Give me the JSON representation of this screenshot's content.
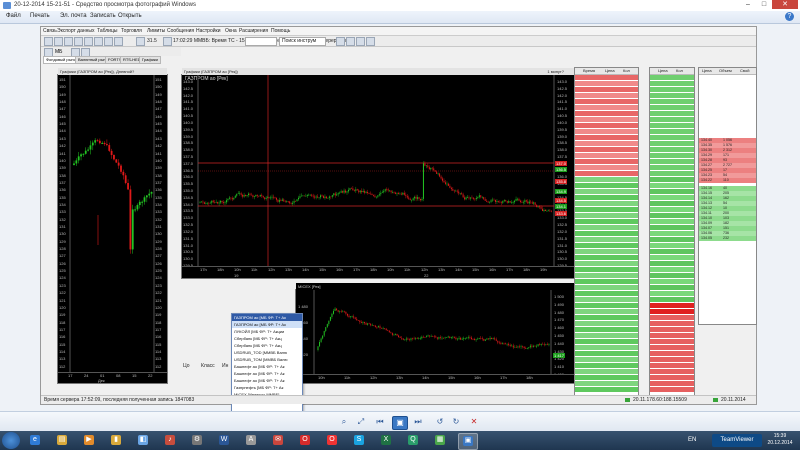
{
  "viewer": {
    "title": "20-12-2014 15-21-51 - Средство просмотра фотографий Windows",
    "menu": [
      "Файл",
      "Печать",
      "Эл. почта",
      "Записать",
      "Открыть"
    ],
    "help": "?"
  },
  "app": {
    "menu": [
      "Связь",
      "Экспорт данных",
      "Таблицы",
      "Торговля",
      "Лимиты",
      "Сообщения",
      "Настройки",
      "Окна",
      "Расширения",
      "Помощь"
    ],
    "toolbar_time": "31.5",
    "toolbar_status": "17:02:29 ММВБ: Время ТС - 15:13:32, Биннинг С 20 декабря (не перерасчет)",
    "toolbar_search": "Поиск инструм",
    "toolbar_account": "МБ",
    "tabs": [
      "Фондовый рынок",
      "Валютный рынок",
      "FORTS",
      "RTS-HEDG",
      "Графики"
    ],
    "status": "Время сервера 17:52:09, последняя полученная запись 1847083",
    "status_right": "20.11.178.60:188.15509",
    "status_date": "20.11.2014",
    "side_labels": [
      "Цо",
      "Класс",
      "Ин"
    ]
  },
  "chart_left": {
    "title": "Графики (ГАЗПРОМ ао [Рек]), Дневной?",
    "ylabels_left": [
      "151",
      "150",
      "149",
      "148",
      "147",
      "146",
      "145",
      "144",
      "143",
      "142",
      "141",
      "140",
      "139",
      "138",
      "137",
      "136",
      "135",
      "134",
      "133",
      "132",
      "131",
      "130",
      "129",
      "128",
      "127",
      "126",
      "125",
      "124",
      "123",
      "122",
      "121",
      "120",
      "119",
      "118",
      "117",
      "116",
      "115",
      "114",
      "113",
      "112",
      "111"
    ],
    "ylabels_right": [
      "151",
      "150",
      "149",
      "148",
      "147",
      "146",
      "145",
      "144",
      "143",
      "142",
      "141",
      "140",
      "139",
      "138",
      "137",
      "136",
      "135",
      "134",
      "133",
      "132",
      "131",
      "130",
      "129",
      "128",
      "127",
      "126",
      "125",
      "124",
      "123",
      "122",
      "121",
      "120",
      "119",
      "118",
      "117",
      "116",
      "115",
      "114",
      "113",
      "112",
      "111"
    ],
    "xlabels": [
      "17",
      "24",
      "01",
      "08",
      "15",
      "22"
    ],
    "xsub": "Дек"
  },
  "chart_main": {
    "title": "Графики (ГАЗПРОМ ао [Рек])",
    "subtitle": "ГАЗПРОМ ао [Рек]",
    "badge": "1 минут?",
    "ylabels_left": [
      "143.0",
      "142.5",
      "142.0",
      "141.5",
      "141.0",
      "140.5",
      "140.0",
      "139.5",
      "139.0",
      "138.5",
      "138.0",
      "137.5",
      "137.0",
      "136.5",
      "136.0",
      "135.5",
      "135.0",
      "134.5",
      "134.0",
      "133.5",
      "133.0",
      "132.5",
      "132.0",
      "131.5",
      "131.0",
      "130.5",
      "130.0",
      "129.5"
    ],
    "ylabels_right": [
      "143.0",
      "142.5",
      "142.0",
      "141.5",
      "141.0",
      "140.5",
      "140.0",
      "139.5",
      "139.0",
      "138.5",
      "138.0",
      "137.5",
      "137.0",
      "136.5",
      "136.0",
      "135.5",
      "135.0",
      "134.5",
      "134.0",
      "133.5",
      "133.0",
      "132.5",
      "132.0",
      "131.5",
      "131.0",
      "130.5",
      "130.0",
      "129.5"
    ],
    "price_tags": [
      "137.0",
      "136.5",
      "135.8",
      "134.9",
      "134.5",
      "134.1",
      "133.6"
    ],
    "xlabels": [
      "17h",
      "18h",
      "10h",
      "11h",
      "12h",
      "13h",
      "14h",
      "15h",
      "16h",
      "17h",
      "18h",
      "10h",
      "11h",
      "12h",
      "13h",
      "14h",
      "15h",
      "16h",
      "17h",
      "18h",
      "19h"
    ],
    "xsub": [
      "19",
      "22"
    ]
  },
  "chart_micex": {
    "title": "MICEX [Рек]",
    "ylabels_right": [
      "1 500",
      "1 490",
      "1 480",
      "1 470",
      "1 460",
      "1 450",
      "1 440",
      "1 430",
      "1 420",
      "1 410",
      "1 400"
    ],
    "ylabels_left": [
      "1 480",
      "1 460",
      "1 440",
      "1 420"
    ],
    "price_tag": "1 417",
    "xlabels": [
      "10h",
      "11h",
      "12h",
      "13h",
      "14h",
      "15h",
      "16h",
      "17h",
      "18h"
    ]
  },
  "instruments": {
    "header": "ГАЗПРОМ ао [МБ ФР: Т+ Ак",
    "items": [
      "ГАЗПРОМ ао [МБ ФР: Т+ Ак",
      "ЛУКОЙЛ [МБ ФР: Т+ Акции",
      "Сбербанк [МБ ФР: Т+ Акц",
      "Сбербанк [МБ ФР: Т+ Акц",
      "USDRUB_TOD [ММВБ Валю",
      "USDRUB_TOM [ММВБ Валю",
      "Башнефт ао [МБ ФР: Т+ Ак",
      "Башнефт ао [МБ ФР: Т+ Ак",
      "Башнефт ао [МБ ФР: Т+ Ак",
      "Газпрнефть [МБ ФР: Т+ Ак",
      "MICEX [Индексы ММВБ]"
    ]
  },
  "book1": {
    "title": "Тоб",
    "headers": [
      "Время",
      "Цена",
      "Кол"
    ],
    "rows_red": 17,
    "rows_green": 36
  },
  "book2": {
    "headers": [
      "Цена",
      "Кол"
    ],
    "rows": 53
  },
  "book3": {
    "headers": [
      "Цена",
      "Объем",
      "Свой"
    ],
    "ask": [
      [
        "134.40",
        "1 056"
      ],
      [
        "134.35",
        "1 576"
      ],
      [
        "134.30",
        "2 312"
      ],
      [
        "134.29",
        "171"
      ],
      [
        "134.28",
        "93"
      ],
      [
        "134.27",
        "2 727"
      ],
      [
        "134.25",
        "17"
      ],
      [
        "134.23",
        "54"
      ],
      [
        "134.22",
        "110"
      ]
    ],
    "bid": [
      [
        "134.16",
        "40"
      ],
      [
        "134.15",
        "205"
      ],
      [
        "134.14",
        "162"
      ],
      [
        "134.13",
        "54"
      ],
      [
        "134.12",
        "10"
      ],
      [
        "134.11",
        "200"
      ],
      [
        "134.10",
        "103"
      ],
      [
        "134.09",
        "182"
      ],
      [
        "134.07",
        "151"
      ],
      [
        "134.06",
        "736"
      ],
      [
        "134.05",
        "232"
      ]
    ]
  },
  "controls": {
    "icons": [
      "search-icon",
      "actual-size-icon",
      "prev-icon",
      "slideshow-icon",
      "next-icon",
      "rotate-left-icon",
      "rotate-right-icon",
      "delete-icon"
    ]
  },
  "taskbar": {
    "apps": [
      "ie-icon",
      "explorer-icon",
      "media-icon",
      "folder-icon",
      "photo-icon",
      "music-icon",
      "settings-icon",
      "word-icon",
      "app-a-icon",
      "mail-icon",
      "opera-icon",
      "opera-red-icon",
      "skype-icon",
      "excel-icon",
      "quik-icon",
      "grid-icon",
      "photoviewer-icon"
    ],
    "lang": "EN",
    "teamviewer": "TeamViewer",
    "time": "15:39",
    "date": "20.12.2014"
  }
}
